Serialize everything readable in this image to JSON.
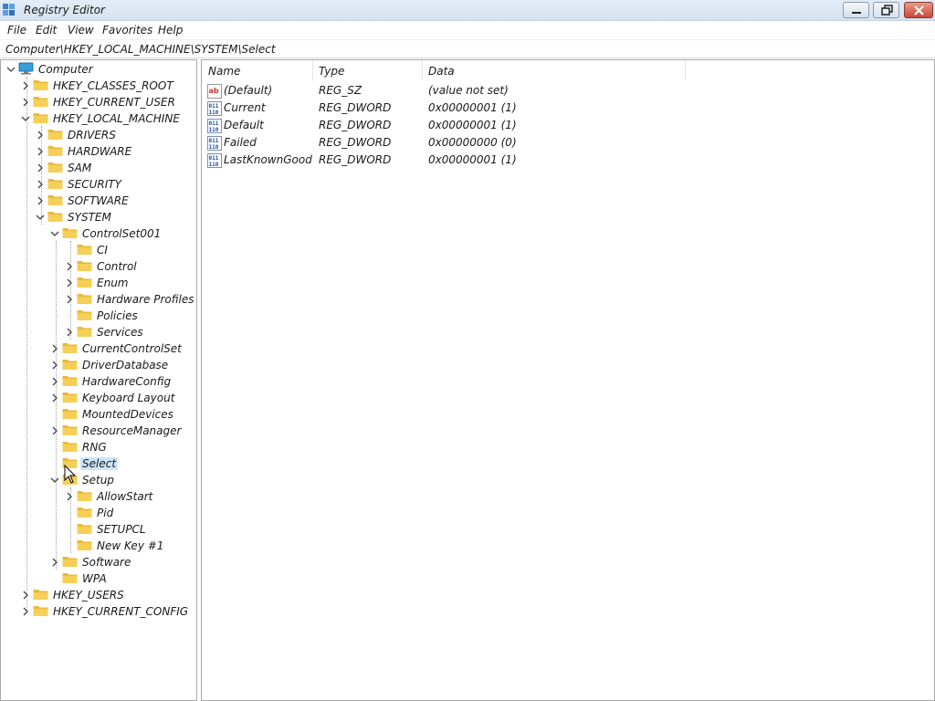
{
  "window": {
    "title": "Registry Editor"
  },
  "menu": [
    "File",
    "Edit",
    "View",
    "Favorites",
    "Help"
  ],
  "address": "Computer\\HKEY_LOCAL_MACHINE\\SYSTEM\\Select",
  "tree": [
    {
      "label": "Computer",
      "level": 0,
      "expander": "expanded",
      "icon": "computer-icon"
    },
    {
      "label": "HKEY_CLASSES_ROOT",
      "level": 1,
      "expander": "collapsed"
    },
    {
      "label": "HKEY_CURRENT_USER",
      "level": 1,
      "expander": "collapsed"
    },
    {
      "label": "HKEY_LOCAL_MACHINE",
      "level": 1,
      "expander": "expanded"
    },
    {
      "label": "DRIVERS",
      "level": 2,
      "expander": "collapsed"
    },
    {
      "label": "HARDWARE",
      "level": 2,
      "expander": "collapsed"
    },
    {
      "label": "SAM",
      "level": 2,
      "expander": "collapsed"
    },
    {
      "label": "SECURITY",
      "level": 2,
      "expander": "collapsed"
    },
    {
      "label": "SOFTWARE",
      "level": 2,
      "expander": "collapsed"
    },
    {
      "label": "SYSTEM",
      "level": 2,
      "expander": "expanded"
    },
    {
      "label": "ControlSet001",
      "level": 3,
      "expander": "expanded"
    },
    {
      "label": "CI",
      "level": 4,
      "expander": "none"
    },
    {
      "label": "Control",
      "level": 4,
      "expander": "collapsed"
    },
    {
      "label": "Enum",
      "level": 4,
      "expander": "collapsed"
    },
    {
      "label": "Hardware Profiles",
      "level": 4,
      "expander": "collapsed"
    },
    {
      "label": "Policies",
      "level": 4,
      "expander": "none"
    },
    {
      "label": "Services",
      "level": 4,
      "expander": "collapsed"
    },
    {
      "label": "CurrentControlSet",
      "level": 3,
      "expander": "collapsed"
    },
    {
      "label": "DriverDatabase",
      "level": 3,
      "expander": "collapsed"
    },
    {
      "label": "HardwareConfig",
      "level": 3,
      "expander": "collapsed"
    },
    {
      "label": "Keyboard Layout",
      "level": 3,
      "expander": "collapsed"
    },
    {
      "label": "MountedDevices",
      "level": 3,
      "expander": "none"
    },
    {
      "label": "ResourceManager",
      "level": 3,
      "expander": "collapsed"
    },
    {
      "label": "RNG",
      "level": 3,
      "expander": "none"
    },
    {
      "label": "Select",
      "level": 3,
      "expander": "none",
      "selected": true
    },
    {
      "label": "Setup",
      "level": 3,
      "expander": "expanded"
    },
    {
      "label": "AllowStart",
      "level": 4,
      "expander": "collapsed"
    },
    {
      "label": "Pid",
      "level": 4,
      "expander": "none"
    },
    {
      "label": "SETUPCL",
      "level": 4,
      "expander": "none"
    },
    {
      "label": "New Key #1",
      "level": 4,
      "expander": "none"
    },
    {
      "label": "Software",
      "level": 3,
      "expander": "collapsed"
    },
    {
      "label": "WPA",
      "level": 3,
      "expander": "none"
    },
    {
      "label": "HKEY_USERS",
      "level": 1,
      "expander": "collapsed"
    },
    {
      "label": "HKEY_CURRENT_CONFIG",
      "level": 1,
      "expander": "collapsed"
    }
  ],
  "columns": {
    "name": "Name",
    "type": "Type",
    "data": "Data"
  },
  "values": [
    {
      "name": "(Default)",
      "type": "REG_SZ",
      "data": "(value not set)",
      "icon": "string-value-icon"
    },
    {
      "name": "Current",
      "type": "REG_DWORD",
      "data": "0x00000001 (1)",
      "icon": "binary-value-icon"
    },
    {
      "name": "Default",
      "type": "REG_DWORD",
      "data": "0x00000001 (1)",
      "icon": "binary-value-icon"
    },
    {
      "name": "Failed",
      "type": "REG_DWORD",
      "data": "0x00000000 (0)",
      "icon": "binary-value-icon"
    },
    {
      "name": "LastKnownGood",
      "type": "REG_DWORD",
      "data": "0x00000001 (1)",
      "icon": "binary-value-icon"
    }
  ],
  "colors": {
    "folder": "#f6cf57",
    "selection": "#cce4f7",
    "titlebar": "#dbe5f1"
  }
}
